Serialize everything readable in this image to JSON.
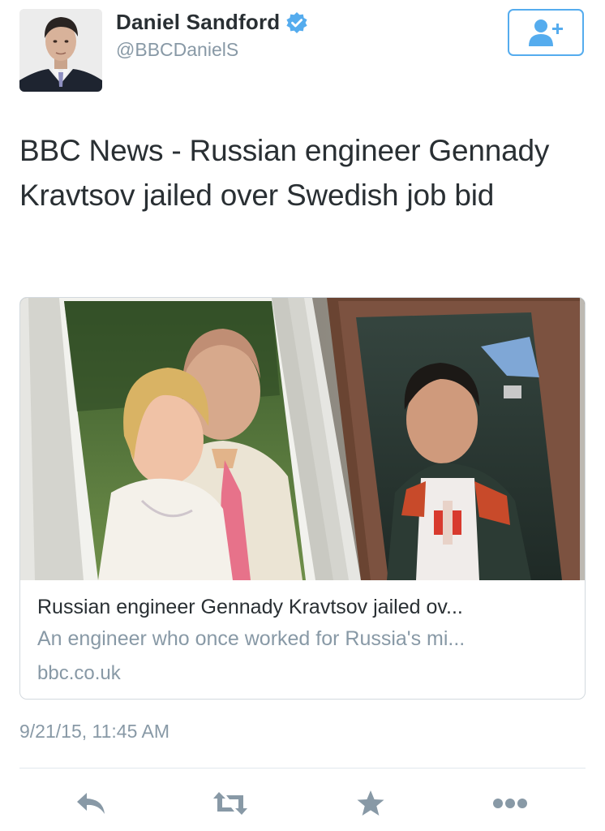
{
  "author": {
    "name": "Daniel Sandford",
    "handle": "@BBCDanielS",
    "verified_icon": "verified-badge-icon",
    "avatar_icon": "profile-photo"
  },
  "follow_button": {
    "icon": "add-user-icon"
  },
  "tweet": {
    "text": "BBC News - Russian engineer Gennady Kravtsov jailed over Swedish job bid",
    "timestamp": "9/21/15, 11:45 AM"
  },
  "card": {
    "image_icon": "article-photo",
    "title": "Russian engineer Gennady Kravtsov jailed ov...",
    "description": "An engineer who once worked for Russia's mi...",
    "domain": "bbc.co.uk"
  },
  "actions": [
    {
      "icon": "reply-icon"
    },
    {
      "icon": "retweet-icon"
    },
    {
      "icon": "favorite-star-icon"
    },
    {
      "icon": "more-icon"
    }
  ],
  "colors": {
    "accent": "#55acee",
    "text": "#292f33",
    "muted": "#8899a6",
    "border": "#d3d9de"
  }
}
